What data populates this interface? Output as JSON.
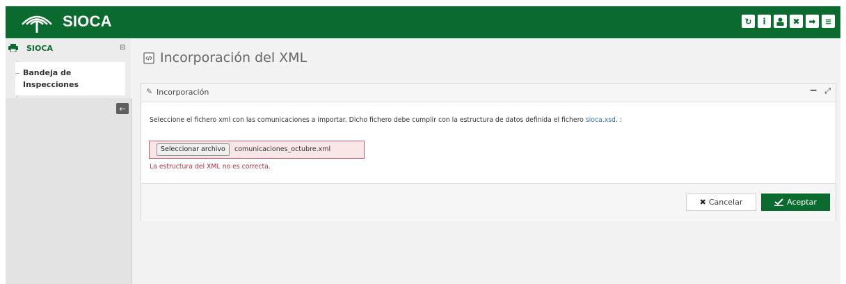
{
  "app": {
    "brand": "SIOCA",
    "brand_color": "#0b6b2e"
  },
  "toolbar": {
    "icons": [
      "refresh-icon",
      "info-icon",
      "user-icon",
      "fullscreen-icon",
      "logout-icon",
      "menu-icon"
    ]
  },
  "sidebar": {
    "header_label": "SIOCA",
    "items": [
      {
        "label_line1": "Bandeja de",
        "label_line2": "Inspecciones"
      }
    ]
  },
  "page": {
    "title": "Incorporación del XML"
  },
  "panel": {
    "title": "Incorporación",
    "intro_text": "Seleccione el fichero xml con las comunicaciones a importar. Dicho fichero debe cumplir con la estructura de datos definida el fichero ",
    "intro_link": "sioca.xsd",
    "intro_suffix": ". :",
    "file_button_label": "Seleccionar archivo",
    "file_name": "comunicaciones_octubre.xml",
    "error_text": "La estructura del XML no es correcta.",
    "error_color": "#b03040"
  },
  "actions": {
    "cancel_label": "Cancelar",
    "accept_label": "Aceptar"
  }
}
